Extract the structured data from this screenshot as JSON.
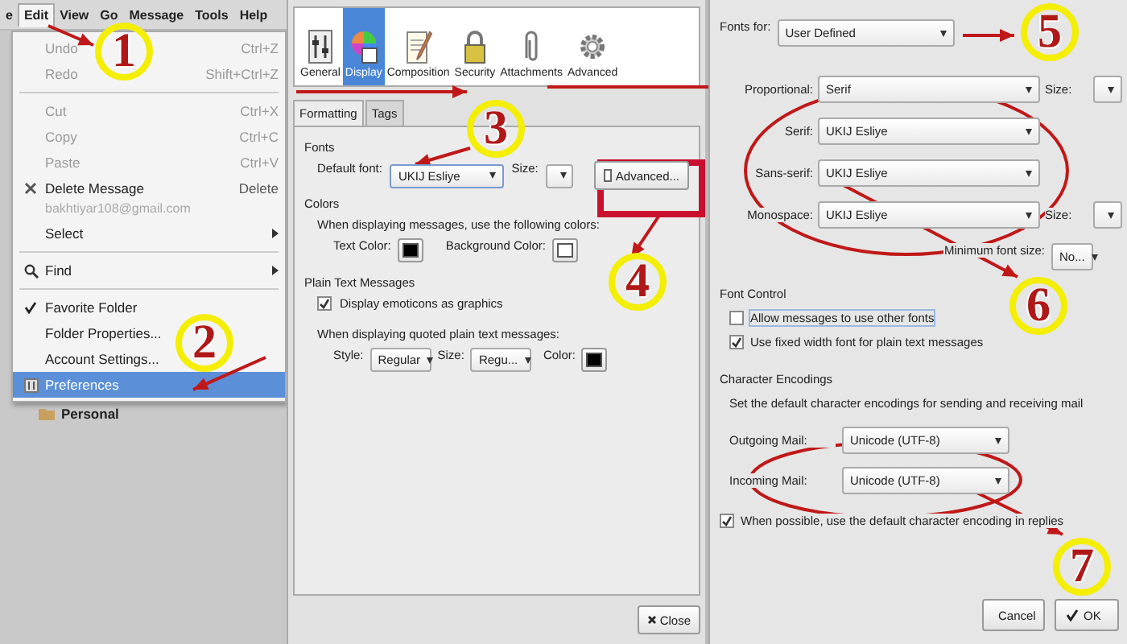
{
  "menubar": {
    "items": [
      {
        "label": "e",
        "selected": false
      },
      {
        "label": "Edit",
        "selected": true
      },
      {
        "label": "View",
        "selected": false
      },
      {
        "label": "Go",
        "selected": false
      },
      {
        "label": "Message",
        "selected": false
      },
      {
        "label": "Tools",
        "selected": false
      },
      {
        "label": "Help",
        "selected": false
      }
    ]
  },
  "edit_menu": {
    "items": [
      {
        "kind": "command",
        "label": "Undo",
        "shortcut": "Ctrl+Z",
        "disabled": true
      },
      {
        "kind": "command",
        "label": "Redo",
        "shortcut": "Shift+Ctrl+Z",
        "disabled": true
      },
      {
        "kind": "separator"
      },
      {
        "kind": "command",
        "label": "Cut",
        "shortcut": "Ctrl+X",
        "disabled": true
      },
      {
        "kind": "command",
        "label": "Copy",
        "shortcut": "Ctrl+C",
        "disabled": true
      },
      {
        "kind": "command",
        "label": "Paste",
        "shortcut": "Ctrl+V",
        "disabled": true
      },
      {
        "kind": "command",
        "label": "Delete Message",
        "shortcut": "Delete",
        "disabled": false
      },
      {
        "kind": "note",
        "label": "bakhtiyar108@gmail.com"
      },
      {
        "kind": "submenu",
        "label": "Select"
      },
      {
        "kind": "separator"
      },
      {
        "kind": "submenu",
        "label": "Find"
      },
      {
        "kind": "separator"
      },
      {
        "kind": "check",
        "label": "Favorite Folder",
        "checked": true
      },
      {
        "kind": "command",
        "label": "Folder Properties...",
        "disabled": false
      },
      {
        "kind": "command",
        "label": "Account Settings...",
        "disabled": false
      },
      {
        "kind": "command",
        "label": "Preferences",
        "disabled": false,
        "selected": true
      }
    ]
  },
  "folder_list": {
    "items": [
      {
        "label": "Personal"
      }
    ]
  },
  "preferences": {
    "categories": [
      {
        "label": "General",
        "selected": false
      },
      {
        "label": "Display",
        "selected": true
      },
      {
        "label": "Composition",
        "selected": false
      },
      {
        "label": "Security",
        "selected": false
      },
      {
        "label": "Attachments",
        "selected": false
      },
      {
        "label": "Advanced",
        "selected": false
      }
    ],
    "tabs": [
      {
        "label": "Formatting",
        "selected": true
      },
      {
        "label": "Tags",
        "selected": false
      }
    ],
    "fonts": {
      "heading": "Fonts",
      "default_font_label": "Default font:",
      "default_font": "UKIJ Esliye",
      "size_label": "Size:",
      "advanced_button": "Advanced..."
    },
    "colors": {
      "heading": "Colors",
      "description": "When displaying messages, use the following colors:",
      "swatches": [
        {
          "label": "Text Color:",
          "color": "#000000"
        },
        {
          "label": "Background Color:",
          "color": "#ffffff"
        }
      ]
    },
    "plain_text": {
      "heading": "Plain Text Messages",
      "emoticons": {
        "label": "Display emoticons as graphics",
        "checked": true
      },
      "quoted_description": "When displaying quoted plain text messages:",
      "style_label": "Style:",
      "style": "Regular",
      "size_label": "Size:",
      "size": "Regu...",
      "color_label": "Color:",
      "color": "#000000"
    },
    "close_button": "Close"
  },
  "fonts_dialog": {
    "fonts_for_label": "Fonts for:",
    "fonts_for": "User Defined",
    "font_rows": [
      {
        "label": "Proportional:",
        "value": "Serif",
        "size_label": "Size:"
      },
      {
        "label": "Serif:",
        "value": "UKIJ Esliye"
      },
      {
        "label": "Sans-serif:",
        "value": "UKIJ Esliye"
      },
      {
        "label": "Monospace:",
        "value": "UKIJ Esliye",
        "size_label": "Size:"
      }
    ],
    "minimum_size_label": "Minimum font size:",
    "minimum_size": "No...",
    "font_control": {
      "heading": "Font Control",
      "options": [
        {
          "label": "Allow messages to use other fonts",
          "checked": false
        },
        {
          "label": "Use fixed width font for plain text messages",
          "checked": true
        }
      ]
    },
    "encodings": {
      "heading": "Character Encodings",
      "description": "Set the default character encodings for sending and receiving mail",
      "rows": [
        {
          "label": "Outgoing Mail:",
          "value": "Unicode (UTF-8)"
        },
        {
          "label": "Incoming Mail:",
          "value": "Unicode (UTF-8)"
        }
      ],
      "replies": {
        "label": "When possible, use the default character encoding in replies",
        "checked": true
      }
    },
    "buttons": [
      {
        "kind": "cancel",
        "label": "Cancel"
      },
      {
        "kind": "ok",
        "label": "OK"
      }
    ]
  },
  "annotations": [
    {
      "number": "1"
    },
    {
      "number": "2"
    },
    {
      "number": "3"
    },
    {
      "number": "4"
    },
    {
      "number": "5"
    },
    {
      "number": "6"
    },
    {
      "number": "7"
    }
  ]
}
